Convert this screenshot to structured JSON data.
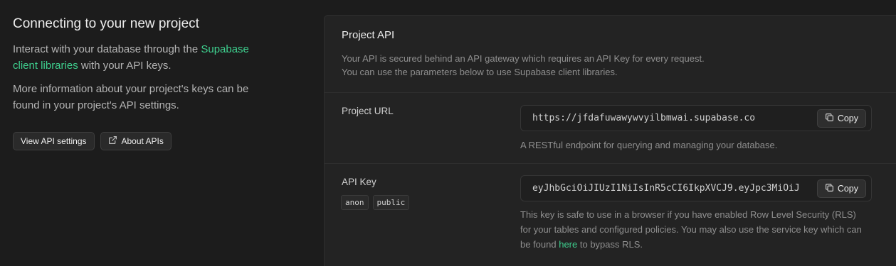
{
  "intro": {
    "title": "Connecting to your new project",
    "para1_before": "Interact with your database through the ",
    "para1_link": "Supabase client libraries",
    "para1_after": " with your API keys.",
    "para2": "More information about your project's keys can be found in your project's API settings.",
    "view_api_settings": "View API settings",
    "about_apis": "About APIs",
    "about_icon": "external-link-icon"
  },
  "panel": {
    "title": "Project API",
    "desc_line1": "Your API is secured behind an API gateway which requires an API Key for every request.",
    "desc_line2": "You can use the parameters below to use Supabase client libraries."
  },
  "project_url": {
    "label": "Project URL",
    "value": "https://jfdafuwawywvyilbmwai.supabase.co",
    "copy_label": "Copy",
    "helper": "A RESTful endpoint for querying and managing your database."
  },
  "api_key": {
    "label": "API Key",
    "tags": [
      "anon",
      "public"
    ],
    "value": "eyJhbGciOiJIUzI1NiIsInR5cCI6IkpXVCJ9.eyJpc3MiOiJ",
    "copy_label": "Copy",
    "helper_before": "This key is safe to use in a browser if you have enabled Row Level Security (RLS) for your tables and configured policies. You may also use the service key which can be found ",
    "helper_link": "here",
    "helper_after": " to bypass RLS."
  },
  "colors": {
    "background": "#1c1c1c",
    "panel": "#232323",
    "accent_green": "#3ecf8e"
  }
}
